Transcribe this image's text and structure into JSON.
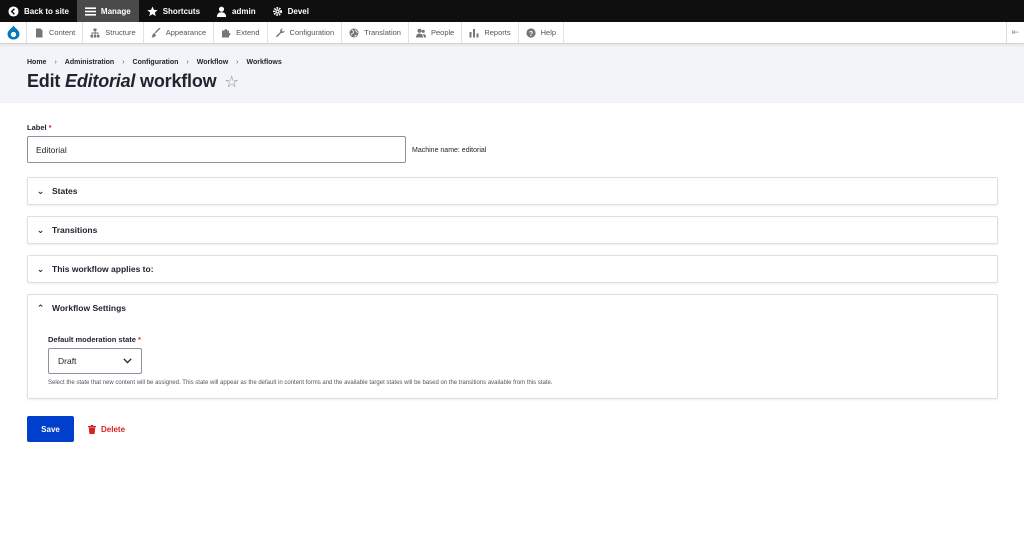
{
  "toolbar": {
    "back": "Back to site",
    "manage": "Manage",
    "shortcuts": "Shortcuts",
    "user": "admin",
    "devel": "Devel"
  },
  "tray": {
    "items": [
      "Content",
      "Structure",
      "Appearance",
      "Extend",
      "Configuration",
      "Translation",
      "People",
      "Reports",
      "Help"
    ]
  },
  "breadcrumb": [
    "Home",
    "Administration",
    "Configuration",
    "Workflow",
    "Workflows"
  ],
  "title": {
    "prefix": "Edit",
    "name": "Editorial",
    "suffix": "workflow"
  },
  "form": {
    "label_label": "Label",
    "label_value": "Editorial",
    "machine_name": "Machine name: editorial",
    "sections": {
      "states": "States",
      "transitions": "Transitions",
      "applies": "This workflow applies to:",
      "settings": "Workflow Settings"
    },
    "default_state_label": "Default moderation state",
    "default_state_value": "Draft",
    "default_state_desc": "Select the state that new content will be assigned. This state will appear as the default in content forms and the available target states will be based on the transitions available from this state.",
    "save": "Save",
    "delete": "Delete"
  },
  "colors": {
    "primary": "#003ecc",
    "danger": "#d72222",
    "toolbar": "#0f0f0f"
  }
}
